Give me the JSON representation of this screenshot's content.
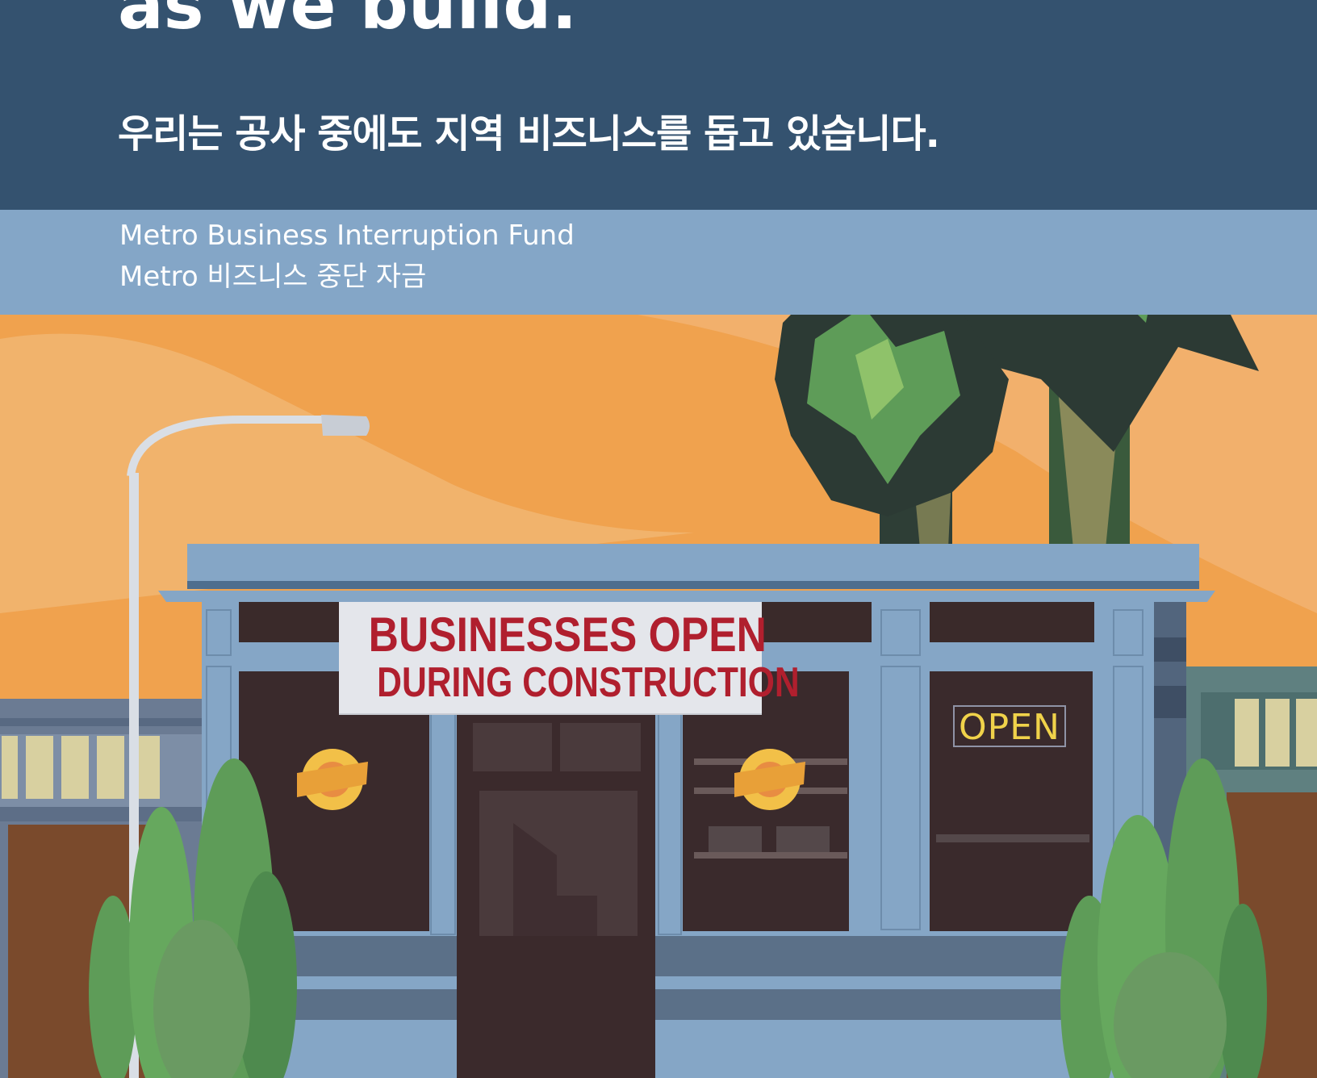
{
  "header": {
    "title_en": "as we build.",
    "title_ko": "우리는 공사 중에도 지역 비즈니스를 돕고 있습니다."
  },
  "fund": {
    "name_en": "Metro Business Interruption Fund",
    "name_ko": "Metro 비즈니스 중단 자금"
  },
  "storefront": {
    "banner_line1": "BUSINESSES OPEN",
    "banner_line2": "DURING CONSTRUCTION",
    "window_sign": "OPEN"
  },
  "colors": {
    "header_bg": "#34526F",
    "band_bg": "#84A6C7",
    "sky": "#F0A24E",
    "banner_text": "#B01F2E",
    "neon": "#F0D24A"
  }
}
